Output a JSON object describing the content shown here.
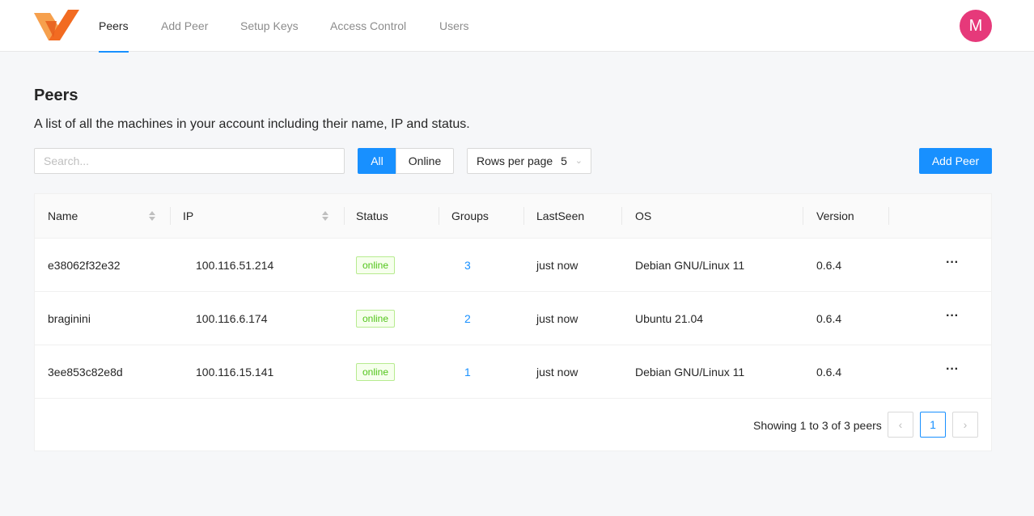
{
  "nav": {
    "items": [
      {
        "label": "Peers",
        "active": true
      },
      {
        "label": "Add Peer",
        "active": false
      },
      {
        "label": "Setup Keys",
        "active": false
      },
      {
        "label": "Access Control",
        "active": false
      },
      {
        "label": "Users",
        "active": false
      }
    ],
    "avatar_initial": "M",
    "avatar_color": "#e6397a",
    "accent_color": "#1890ff"
  },
  "page": {
    "title": "Peers",
    "description": "A list of all the machines in your account including their name, IP and status."
  },
  "toolbar": {
    "search_placeholder": "Search...",
    "search_value": "",
    "filter_all": "All",
    "filter_online": "Online",
    "rows_label": "Rows per page",
    "rows_value": "5",
    "add_button": "Add Peer"
  },
  "table": {
    "headers": [
      "Name",
      "IP",
      "Status",
      "Groups",
      "LastSeen",
      "OS",
      "Version"
    ],
    "rows": [
      {
        "name": "e38062f32e32",
        "ip": "100.116.51.214",
        "status": "online",
        "groups": "3",
        "last_seen": "just now",
        "os": "Debian GNU/Linux 11",
        "version": "0.6.4",
        "actions": "···"
      },
      {
        "name": "braginini",
        "ip": "100.116.6.174",
        "status": "online",
        "groups": "2",
        "last_seen": "just now",
        "os": "Ubuntu 21.04",
        "version": "0.6.4",
        "actions": "···"
      },
      {
        "name": "3ee853c82e8d",
        "ip": "100.116.15.141",
        "status": "online",
        "groups": "1",
        "last_seen": "just now",
        "os": "Debian GNU/Linux 11",
        "version": "0.6.4",
        "actions": "···"
      }
    ]
  },
  "pagination": {
    "summary": "Showing 1 to 3 of 3 peers",
    "prev": "‹",
    "current_page": "1",
    "next": "›"
  }
}
